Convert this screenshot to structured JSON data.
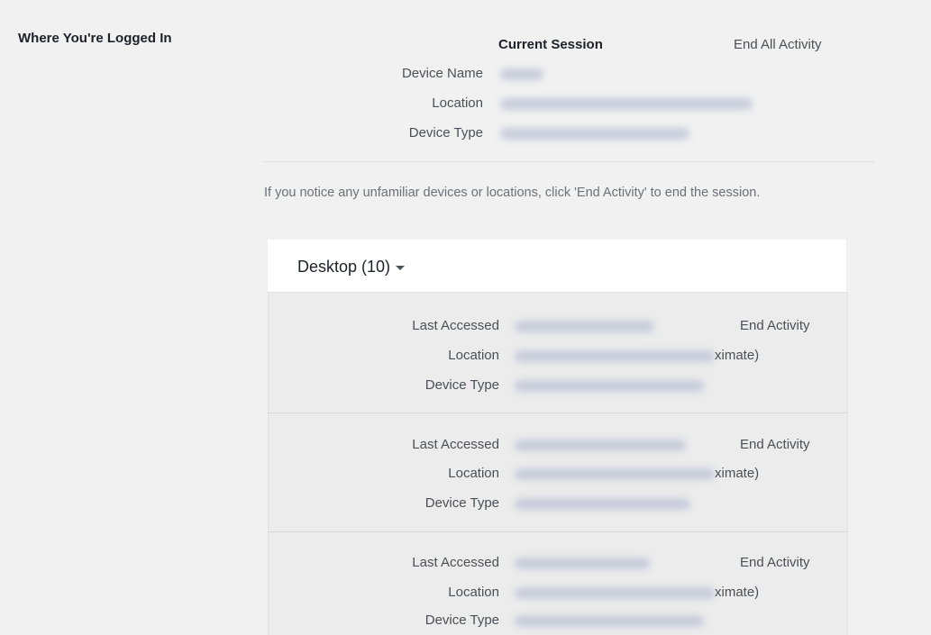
{
  "section_title": "Where You're Logged In",
  "current_session": {
    "heading": "Current Session",
    "end_all_label": "End All Activity",
    "labels": {
      "device_name": "Device Name",
      "location": "Location",
      "device_type": "Device Type"
    }
  },
  "notice": "If you notice any unfamiliar devices or locations, click 'End Activity' to end the session.",
  "device_group": {
    "title": "Desktop (10)",
    "sessions": [
      {
        "last_accessed_label": "Last Accessed",
        "location_label": "Location",
        "device_type_label": "Device Type",
        "location_suffix": "ximate)",
        "end_activity": "End Activity"
      },
      {
        "last_accessed_label": "Last Accessed",
        "location_label": "Location",
        "device_type_label": "Device Type",
        "location_suffix": "ximate)",
        "end_activity": "End Activity"
      },
      {
        "last_accessed_label": "Last Accessed",
        "location_label": "Location",
        "device_type_label": "Device Type",
        "location_suffix": "ximate)",
        "end_activity": "End Activity"
      }
    ]
  }
}
